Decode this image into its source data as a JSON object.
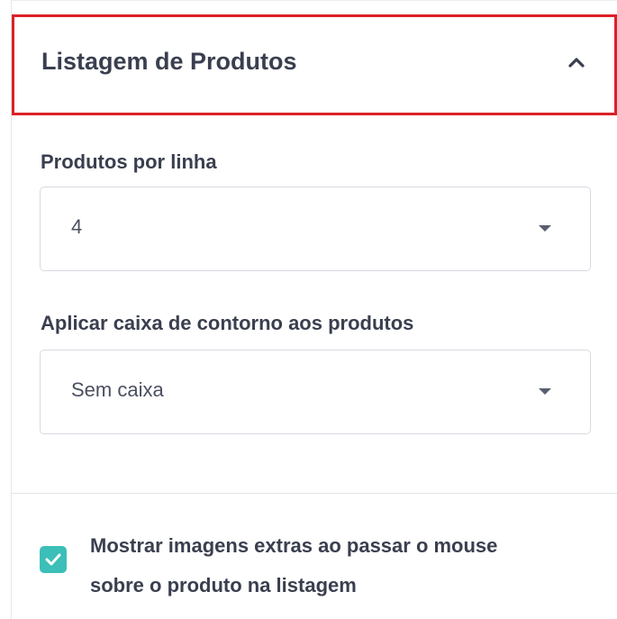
{
  "section": {
    "title": "Listagem de Produtos",
    "toggle_icon": "chevron-up-icon"
  },
  "fields": {
    "products_per_row": {
      "label": "Produtos por linha",
      "value": "4"
    },
    "outline_box": {
      "label": "Aplicar caixa de contorno aos produtos",
      "value": "Sem caixa"
    }
  },
  "extra_images": {
    "label_line1": "Mostrar imagens extras ao passar o mouse",
    "label_line2": "sobre o produto na listagem",
    "checked": true
  },
  "colors": {
    "highlight_border": "#dc2027",
    "checkbox_accent": "#3bbfb8",
    "text": "#3a3f4f"
  }
}
